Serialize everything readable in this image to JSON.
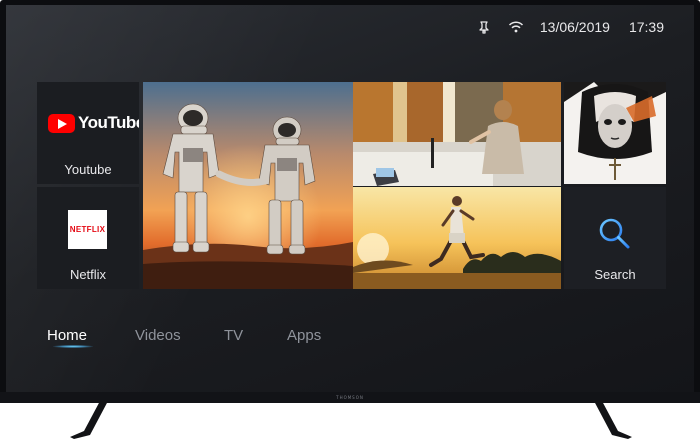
{
  "status": {
    "date": "13/06/2019",
    "time": "17:39",
    "icons": [
      "notification-icon",
      "wifi-icon"
    ]
  },
  "apps": {
    "youtube": {
      "logo_text": "YouTube",
      "label": "Youtube",
      "brand_color": "#ff0000"
    },
    "netflix": {
      "logo_text": "NETFLIX",
      "label": "Netflix",
      "brand_color": "#e50914"
    },
    "search": {
      "label": "Search",
      "icon": "search-icon",
      "icon_color": "#4aa8ff"
    }
  },
  "featured": [
    {
      "id": "astronauts",
      "description_icon": "astronauts-thumbnail"
    },
    {
      "id": "meeting",
      "description_icon": "meeting-thumbnail"
    },
    {
      "id": "nun",
      "description_icon": "nun-thumbnail"
    },
    {
      "id": "runner",
      "description_icon": "runner-thumbnail"
    }
  ],
  "nav": {
    "items": [
      "Home",
      "Videos",
      "TV",
      "Apps"
    ],
    "selected": "Home",
    "accent_color": "#6fd6ff"
  },
  "tv": {
    "brand": "THOMSON"
  }
}
